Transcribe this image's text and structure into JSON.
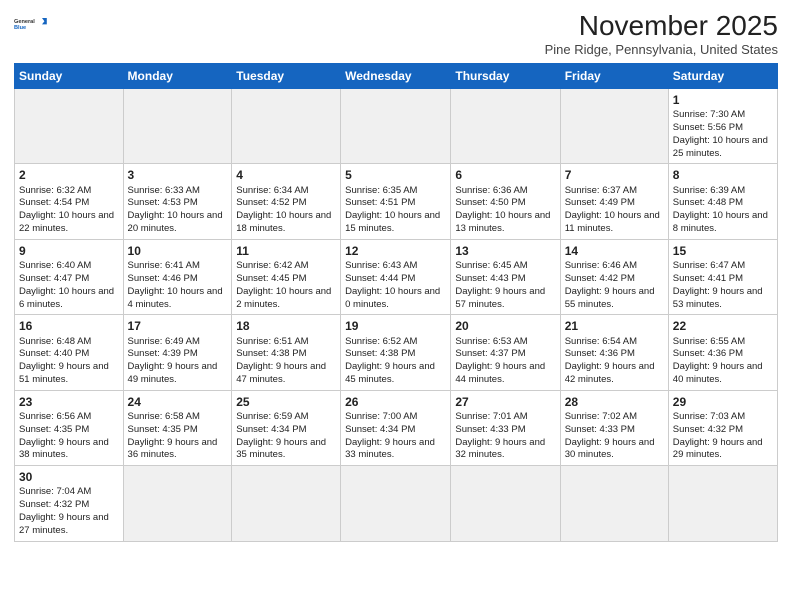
{
  "header": {
    "logo_line1": "General",
    "logo_line2": "Blue",
    "month_title": "November 2025",
    "location": "Pine Ridge, Pennsylvania, United States"
  },
  "weekdays": [
    "Sunday",
    "Monday",
    "Tuesday",
    "Wednesday",
    "Thursday",
    "Friday",
    "Saturday"
  ],
  "weeks": [
    [
      {
        "day": "",
        "info": ""
      },
      {
        "day": "",
        "info": ""
      },
      {
        "day": "",
        "info": ""
      },
      {
        "day": "",
        "info": ""
      },
      {
        "day": "",
        "info": ""
      },
      {
        "day": "",
        "info": ""
      },
      {
        "day": "1",
        "info": "Sunrise: 7:30 AM\nSunset: 5:56 PM\nDaylight: 10 hours and 25 minutes."
      }
    ],
    [
      {
        "day": "2",
        "info": "Sunrise: 6:32 AM\nSunset: 4:54 PM\nDaylight: 10 hours and 22 minutes."
      },
      {
        "day": "3",
        "info": "Sunrise: 6:33 AM\nSunset: 4:53 PM\nDaylight: 10 hours and 20 minutes."
      },
      {
        "day": "4",
        "info": "Sunrise: 6:34 AM\nSunset: 4:52 PM\nDaylight: 10 hours and 18 minutes."
      },
      {
        "day": "5",
        "info": "Sunrise: 6:35 AM\nSunset: 4:51 PM\nDaylight: 10 hours and 15 minutes."
      },
      {
        "day": "6",
        "info": "Sunrise: 6:36 AM\nSunset: 4:50 PM\nDaylight: 10 hours and 13 minutes."
      },
      {
        "day": "7",
        "info": "Sunrise: 6:37 AM\nSunset: 4:49 PM\nDaylight: 10 hours and 11 minutes."
      },
      {
        "day": "8",
        "info": "Sunrise: 6:39 AM\nSunset: 4:48 PM\nDaylight: 10 hours and 8 minutes."
      }
    ],
    [
      {
        "day": "9",
        "info": "Sunrise: 6:40 AM\nSunset: 4:47 PM\nDaylight: 10 hours and 6 minutes."
      },
      {
        "day": "10",
        "info": "Sunrise: 6:41 AM\nSunset: 4:46 PM\nDaylight: 10 hours and 4 minutes."
      },
      {
        "day": "11",
        "info": "Sunrise: 6:42 AM\nSunset: 4:45 PM\nDaylight: 10 hours and 2 minutes."
      },
      {
        "day": "12",
        "info": "Sunrise: 6:43 AM\nSunset: 4:44 PM\nDaylight: 10 hours and 0 minutes."
      },
      {
        "day": "13",
        "info": "Sunrise: 6:45 AM\nSunset: 4:43 PM\nDaylight: 9 hours and 57 minutes."
      },
      {
        "day": "14",
        "info": "Sunrise: 6:46 AM\nSunset: 4:42 PM\nDaylight: 9 hours and 55 minutes."
      },
      {
        "day": "15",
        "info": "Sunrise: 6:47 AM\nSunset: 4:41 PM\nDaylight: 9 hours and 53 minutes."
      }
    ],
    [
      {
        "day": "16",
        "info": "Sunrise: 6:48 AM\nSunset: 4:40 PM\nDaylight: 9 hours and 51 minutes."
      },
      {
        "day": "17",
        "info": "Sunrise: 6:49 AM\nSunset: 4:39 PM\nDaylight: 9 hours and 49 minutes."
      },
      {
        "day": "18",
        "info": "Sunrise: 6:51 AM\nSunset: 4:38 PM\nDaylight: 9 hours and 47 minutes."
      },
      {
        "day": "19",
        "info": "Sunrise: 6:52 AM\nSunset: 4:38 PM\nDaylight: 9 hours and 45 minutes."
      },
      {
        "day": "20",
        "info": "Sunrise: 6:53 AM\nSunset: 4:37 PM\nDaylight: 9 hours and 44 minutes."
      },
      {
        "day": "21",
        "info": "Sunrise: 6:54 AM\nSunset: 4:36 PM\nDaylight: 9 hours and 42 minutes."
      },
      {
        "day": "22",
        "info": "Sunrise: 6:55 AM\nSunset: 4:36 PM\nDaylight: 9 hours and 40 minutes."
      }
    ],
    [
      {
        "day": "23",
        "info": "Sunrise: 6:56 AM\nSunset: 4:35 PM\nDaylight: 9 hours and 38 minutes."
      },
      {
        "day": "24",
        "info": "Sunrise: 6:58 AM\nSunset: 4:35 PM\nDaylight: 9 hours and 36 minutes."
      },
      {
        "day": "25",
        "info": "Sunrise: 6:59 AM\nSunset: 4:34 PM\nDaylight: 9 hours and 35 minutes."
      },
      {
        "day": "26",
        "info": "Sunrise: 7:00 AM\nSunset: 4:34 PM\nDaylight: 9 hours and 33 minutes."
      },
      {
        "day": "27",
        "info": "Sunrise: 7:01 AM\nSunset: 4:33 PM\nDaylight: 9 hours and 32 minutes."
      },
      {
        "day": "28",
        "info": "Sunrise: 7:02 AM\nSunset: 4:33 PM\nDaylight: 9 hours and 30 minutes."
      },
      {
        "day": "29",
        "info": "Sunrise: 7:03 AM\nSunset: 4:32 PM\nDaylight: 9 hours and 29 minutes."
      }
    ],
    [
      {
        "day": "30",
        "info": "Sunrise: 7:04 AM\nSunset: 4:32 PM\nDaylight: 9 hours and 27 minutes."
      },
      {
        "day": "",
        "info": ""
      },
      {
        "day": "",
        "info": ""
      },
      {
        "day": "",
        "info": ""
      },
      {
        "day": "",
        "info": ""
      },
      {
        "day": "",
        "info": ""
      },
      {
        "day": "",
        "info": ""
      }
    ]
  ]
}
